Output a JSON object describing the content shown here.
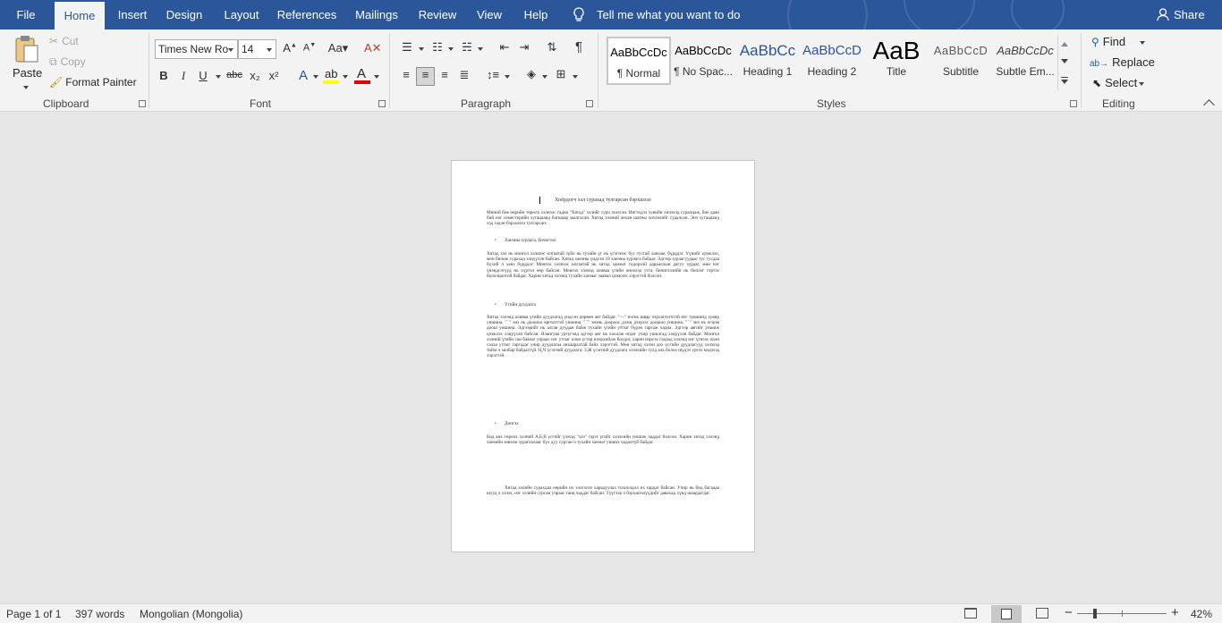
{
  "tabs": [
    "File",
    "Home",
    "Insert",
    "Design",
    "Layout",
    "References",
    "Mailings",
    "Review",
    "View",
    "Help"
  ],
  "tell_me": "Tell me what you want to do",
  "share": "Share",
  "clipboard": {
    "paste": "Paste",
    "cut": "Cut",
    "copy": "Copy",
    "format_painter": "Format Painter",
    "label": "Clipboard"
  },
  "font": {
    "name": "Times New Ro",
    "size": "14",
    "label": "Font",
    "bold": "B",
    "italic": "I",
    "underline": "U",
    "strike": "abc",
    "sub": "x₂",
    "sup": "x²"
  },
  "paragraph": {
    "label": "Paragraph"
  },
  "styles": {
    "label": "Styles",
    "items": [
      {
        "preview": "AaBbCcDc",
        "name": "¶ Normal"
      },
      {
        "preview": "AaBbCcDc",
        "name": "¶ No Spac..."
      },
      {
        "preview": "AaBbCc",
        "name": "Heading 1"
      },
      {
        "preview": "AaBbCcD",
        "name": "Heading 2"
      },
      {
        "preview": "AaB",
        "name": "Title"
      },
      {
        "preview": "AaBbCcD",
        "name": "Subtitle"
      },
      {
        "preview": "AaBbCcDc",
        "name": "Subtle Em..."
      }
    ]
  },
  "editing": {
    "find": "Find",
    "replace": "Replace",
    "select": "Select",
    "label": "Editing"
  },
  "document": {
    "title": "Хоёрдогч хэл сурахад тулгарсан бэрхшээл",
    "p1": "Миний бие өөрийн төрөлх хэлнээс гадна \"Хятад\" хэлийг сурч эхэлсэн. Ингэхдээ хувийн хичээлд суралцаж, бие даан бий нэг семестерийн хугацаанд багшаар заалгасан. Хятад хэлний анхан шатны хичээлийг судалсан. Энэ хугацаанд хэд хэдэн бэрхшээл тулгарсан:",
    "b1": "Ханзны зурлага, бичиглэл",
    "p2": "Хятад хэл нь монгол хэлнээс илгаатай зүйл нь тухайн үг нь үсэгнээс бус тусгай ханзаас бүрддэг. Үүнийг цээжлэх, мөн бичиж сурахад хэцүүхэн байсан. Хятад ханзны үндсэн 18 ханзны зурлага байдаг. Эдгээр зурлагуудаас тус тусдаа бүхий л ханз бүрддэг. Монгол хэлнээс илгаатай нь хятад ханзыг тодорхой дарааллын дагуу зурдаг, мөн нэг үнэндсэтүүд нь хүртэл өөр байсан. Монгол хэлнэд аливаа үгийн оноохэд утга, бичиглэлийн нь бичлэг тэртэх бололцоотой байдаг. Харин хятад хэлэнд тухайн ханзыг заавал цээжлэх хэрэгтэй болсон.",
    "b2": "Үгийн дуудлага",
    "p3": "Хятад хэлэнд аливаа үгийн дуудлагад үндсэн дөрвөн аяг байдаг. \"—\" нэгнь швар чэрхатлэгчтэй нэг түвшинд хуяир уншина, \"ˊ\" энэ нь доошоо өргөлттэй уншина, \"ˇ\" энэнь доороос дээш дээрээс доошоо уншина, \"ˋ\" энэ нь огцом доош уншина. Эдгээрийг нь алгав дуудаж байж тухайн үгийн утгыг бүрэн гаргаж чадна. Эдгээр аягийг уншиж цээжлэх хэцүүхэн байсан. Ялангуяа ургүгэнд эдгээр аяг нь хооллж өгдөг учир ушилгад хэцүүхэн байдаг. Монгол хэлний үгийн сан баялаг учраас нэг утгыг олон үгээр илэрхийлж болдог, харин нэрсэх гадаад хэлэнд нэг үгнээс олон салаа утгыг гаргадаг учир дуудлагаа анхааралтай байх хэрэгтэй. Мөн хятад хэлэн дох үсгийн дуудлагууд хэлэхэд тийм ч хялбар байдаггүй. Ц,Ч үсэгний дуудлага; З,Ж үсэгний дуудлага хэлэхийн тулд аль болох шүдээ ургэх мэдэхэд хэрэгтэй.",
    "b3": "Дөнгэх",
    "p4": "Бид анх төрөлх хэлний А,Б,В үсгийг үзэхэд \"хээ\" гэдэг үгийг хэлэхийн уншиж чаддаг болсон. Харин хятад хэлэнд ханзийн зөвхөн зураглалаас бүх дуу сурсан ч тухайн ханзыг унших чадалгүй байдаг.",
    "p5": "Хятад хэлийн сурахдаа өөрийн их хэлсэлээ харьцуулах тохиолдол их гардаг байсан. Учир нь бид багадаа шууд л хэлэх, нэг хэлийн сурсан учраас ганц чаддаг байсан. Түүгээр ч бэрхшээлүүдийг давахад хүнд шаардагдаг."
  },
  "statusbar": {
    "page": "Page 1 of 1",
    "words": "397 words",
    "language": "Mongolian (Mongolia)",
    "zoom": "42%"
  }
}
